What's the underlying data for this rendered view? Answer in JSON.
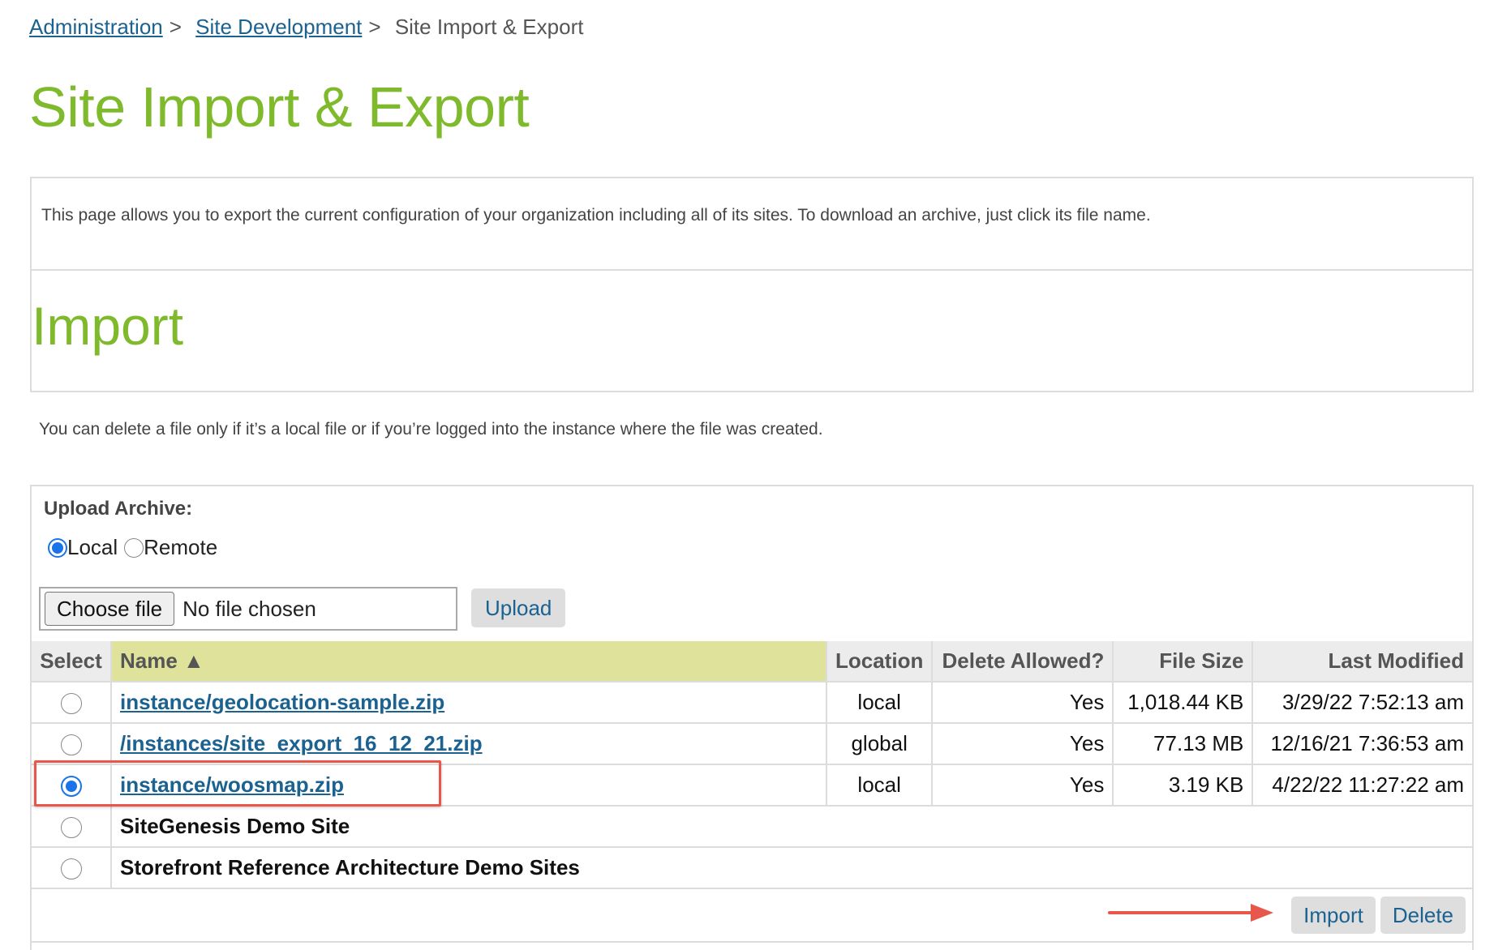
{
  "breadcrumb": {
    "items": [
      {
        "label": "Administration",
        "link": true
      },
      {
        "label": "Site Development",
        "link": true
      },
      {
        "label": "Site Import & Export",
        "link": false
      }
    ],
    "separator": ">"
  },
  "page_title": "Site Import & Export",
  "info_text": "This page allows you to export the current configuration of your organization including all of its sites. To download an archive, just click its file name.",
  "import_heading": "Import",
  "delete_note": "You can delete a file only if it’s a local file or if you’re logged into the instance where the file was created.",
  "upload": {
    "label": "Upload Archive:",
    "options": [
      {
        "label": "Local",
        "checked": true
      },
      {
        "label": "Remote",
        "checked": false
      }
    ],
    "choose_file_label": "Choose file",
    "file_status": "No file chosen",
    "upload_button": "Upload"
  },
  "table": {
    "columns": [
      "Select",
      "Name ▲",
      "Location",
      "Delete Allowed?",
      "File Size",
      "Last Modified"
    ],
    "sorted_column": "Name",
    "files": [
      {
        "name": "instance/geolocation-sample.zip",
        "location": "local",
        "delete_allowed": "Yes",
        "size": "1,018.44 KB",
        "modified": "3/29/22 7:52:13 am",
        "selected": false
      },
      {
        "name": "/instances/site_export_16_12_21.zip",
        "location": "global",
        "delete_allowed": "Yes",
        "size": "77.13 MB",
        "modified": "12/16/21 7:36:53 am",
        "selected": false
      },
      {
        "name": "instance/woosmap.zip",
        "location": "local",
        "delete_allowed": "Yes",
        "size": "3.19 KB",
        "modified": "4/22/22 11:27:22 am",
        "selected": true
      }
    ],
    "demo_sites": [
      {
        "name": "SiteGenesis Demo Site",
        "selected": false
      },
      {
        "name": "Storefront Reference Architecture Demo Sites",
        "selected": false
      }
    ],
    "import_button": "Import",
    "delete_button": "Delete"
  },
  "annotations": {
    "highlight_color": "#e8574c",
    "highlighted_row": "instance/woosmap.zip",
    "arrow_target": "Import"
  },
  "colors": {
    "title_green": "#7fba2c",
    "link_blue": "#1b6290",
    "sorted_header": "#dfe29a",
    "radio_blue": "#1a73e8"
  }
}
